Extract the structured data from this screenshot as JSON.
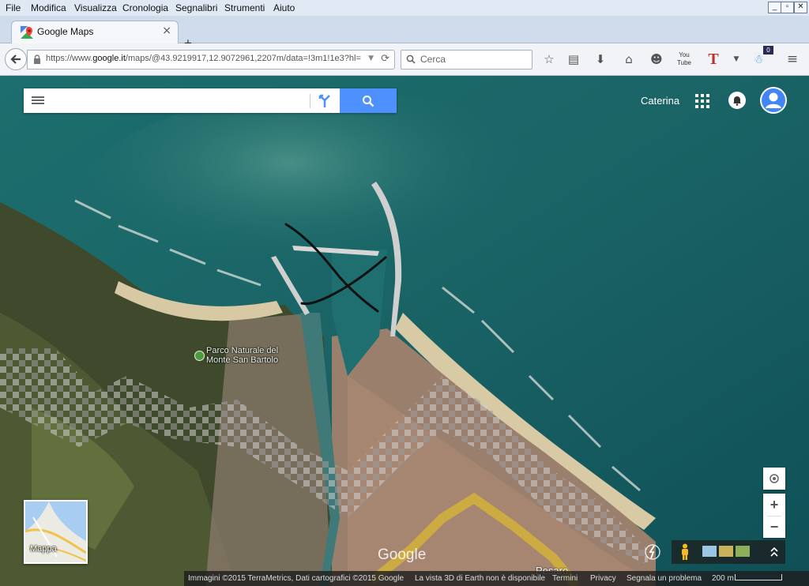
{
  "menu": [
    "File",
    "Modifica",
    "Visualizza",
    "Cronologia",
    "Segnalibri",
    "Strumenti",
    "Aiuto"
  ],
  "window_controls": [
    "minimize-icon",
    "restore-icon",
    "close-icon"
  ],
  "tab": {
    "title": "Google Maps",
    "close": "×"
  },
  "new_tab": "+",
  "url": {
    "prefix": "https://www.",
    "host": "google.it",
    "path": "/maps/@43.9219917,12.9072961,2207m/data=!3m1!1e3?hl="
  },
  "search": {
    "placeholder": "Cerca"
  },
  "toolbar_icons": [
    "star-icon",
    "reading-list-icon",
    "download-icon",
    "home-icon",
    "smiley-icon",
    "youtube-icon",
    "t-icon",
    "ghostery-icon",
    "menu-icon"
  ],
  "toolbar_badge": "0",
  "map": {
    "search_placeholder": "",
    "user_name": "Caterina",
    "park_label_1": "Parco Naturale del",
    "park_label_2": "Monte San Bartolo",
    "minimap_label": "Mappa",
    "logo": "Google",
    "city_label": "Pesaro",
    "zoom_in": "+",
    "zoom_out": "−",
    "footer": {
      "imagery": "Immagini ©2015 TerraMetrics, Dati cartografici ©2015 Google",
      "no3d": "La vista 3D di Earth non è disponibile",
      "terms": "Termini",
      "privacy": "Privacy",
      "report": "Segnala un problema",
      "scale": "200 m"
    }
  }
}
